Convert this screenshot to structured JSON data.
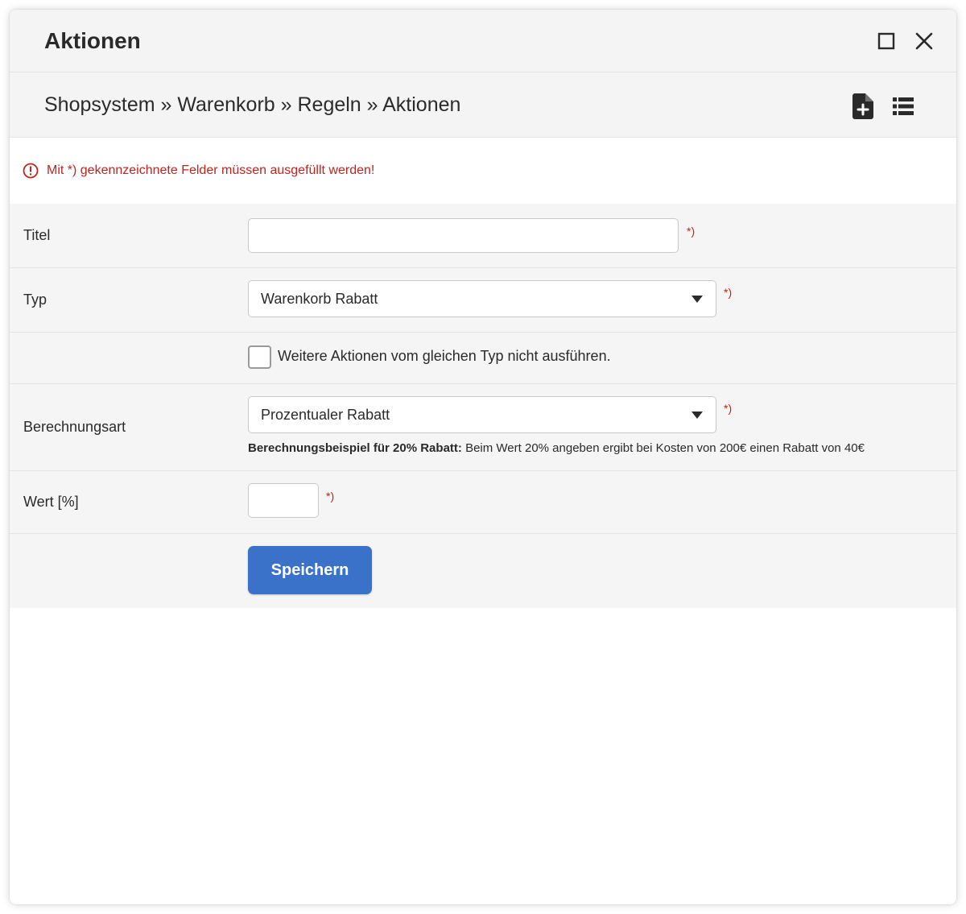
{
  "window": {
    "title": "Aktionen",
    "maximize_icon": "maximize-icon",
    "close_icon": "close-icon"
  },
  "breadcrumb": {
    "text": "Shopsystem » Warenkorb » Regeln » Aktionen",
    "tools": [
      "new-document-icon",
      "list-icon"
    ]
  },
  "notice": {
    "text": "Mit *) gekennzeichnete Felder müssen ausgefüllt werden!",
    "icon": "alert-circle-icon",
    "color": "#c0231c"
  },
  "form": {
    "required_marker": "*)",
    "titel": {
      "label": "Titel",
      "value": "",
      "placeholder": ""
    },
    "typ": {
      "label": "Typ",
      "selected": "Warenkorb Rabatt"
    },
    "checkbox": {
      "label": "Weitere Aktionen vom gleichen Typ nicht ausführen.",
      "checked": false
    },
    "berechnungsart": {
      "label": "Berechnungsart",
      "selected": "Prozentualer Rabatt",
      "hint_bold": "Berechnungsbeispiel für 20% Rabatt:",
      "hint_text": " Beim Wert 20% angeben ergibt bei Kosten von 200€ einen Rabatt von 40€"
    },
    "wert": {
      "label": "Wert [%]",
      "value": ""
    },
    "save_label": "Speichern"
  },
  "colors": {
    "accent": "#3b72c9",
    "required": "#c0231c",
    "panel_bg": "#f4f4f4"
  }
}
